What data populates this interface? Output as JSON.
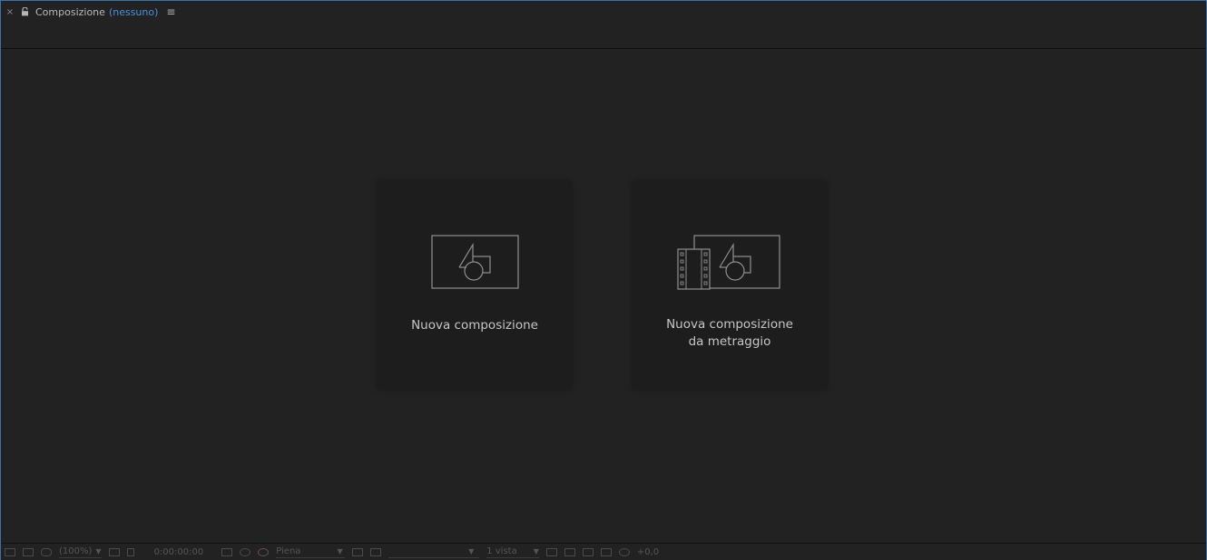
{
  "panel": {
    "close_glyph": "×",
    "title": "Composizione",
    "subtitle": "(nessuno)",
    "menu_glyph": "≡"
  },
  "cards": [
    {
      "label_line1": "Nuova composizione",
      "label_line2": ""
    },
    {
      "label_line1": "Nuova composizione",
      "label_line2": "da metraggio"
    }
  ],
  "statusbar": {
    "zoom": "(100%)",
    "timecode": "0:00:00:00",
    "resolution": "Piena",
    "views": "1 vista",
    "exposure": "+0,0"
  },
  "colors": {
    "accent": "#4a90e2",
    "background": "#232222",
    "card": "#1e1d1e"
  },
  "icons": [
    "close-icon",
    "lock-icon",
    "panel-menu-icon",
    "composition-icon",
    "footage-composition-icon",
    "camera-icon",
    "color-wheel-icon",
    "exposure-icon"
  ]
}
